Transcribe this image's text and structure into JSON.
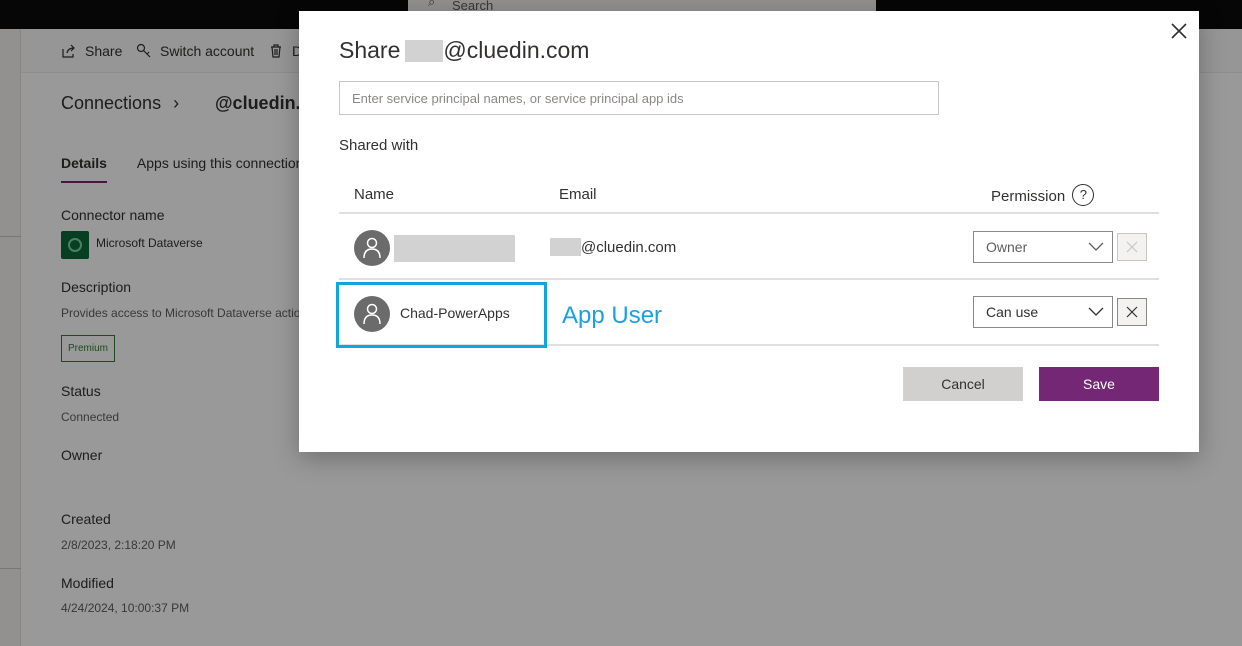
{
  "topbar": {
    "search_label": "Search"
  },
  "commandbar": {
    "share": "Share",
    "switch_account": "Switch account",
    "delete_partial": "D"
  },
  "page": {
    "breadcrumb_root": "Connections",
    "breadcrumb_sep": "›",
    "breadcrumb_current": "@cluedin.c",
    "tabs": [
      "Details",
      "Apps using this connection"
    ],
    "connector_name_label": "Connector name",
    "connector_name_value": "Microsoft Dataverse",
    "description_label": "Description",
    "description_value": "Provides access to Microsoft Dataverse actions",
    "premium_badge": "Premium",
    "status_label": "Status",
    "status_value": "Connected",
    "owner_label": "Owner",
    "created_label": "Created",
    "created_value": "2/8/2023, 2:18:20 PM",
    "modified_label": "Modified",
    "modified_value": "4/24/2024, 10:00:37 PM"
  },
  "dialog": {
    "title_prefix": "Share",
    "title_suffix": "@cluedin.com",
    "search_placeholder": "Enter service principal names, or service principal app ids",
    "shared_with_label": "Shared with",
    "columns": {
      "name": "Name",
      "email": "Email",
      "permission": "Permission",
      "help": "?"
    },
    "rows": [
      {
        "email_suffix": "@cluedin.com",
        "permission": "Owner"
      },
      {
        "name": "Chad-PowerApps",
        "annotation": "App User",
        "permission": "Can use"
      }
    ],
    "cancel_label": "Cancel",
    "save_label": "Save"
  },
  "colors": {
    "save_button": "#742774",
    "annotation": "#1ba1e2",
    "highlight_border": "#0ea5e0"
  }
}
